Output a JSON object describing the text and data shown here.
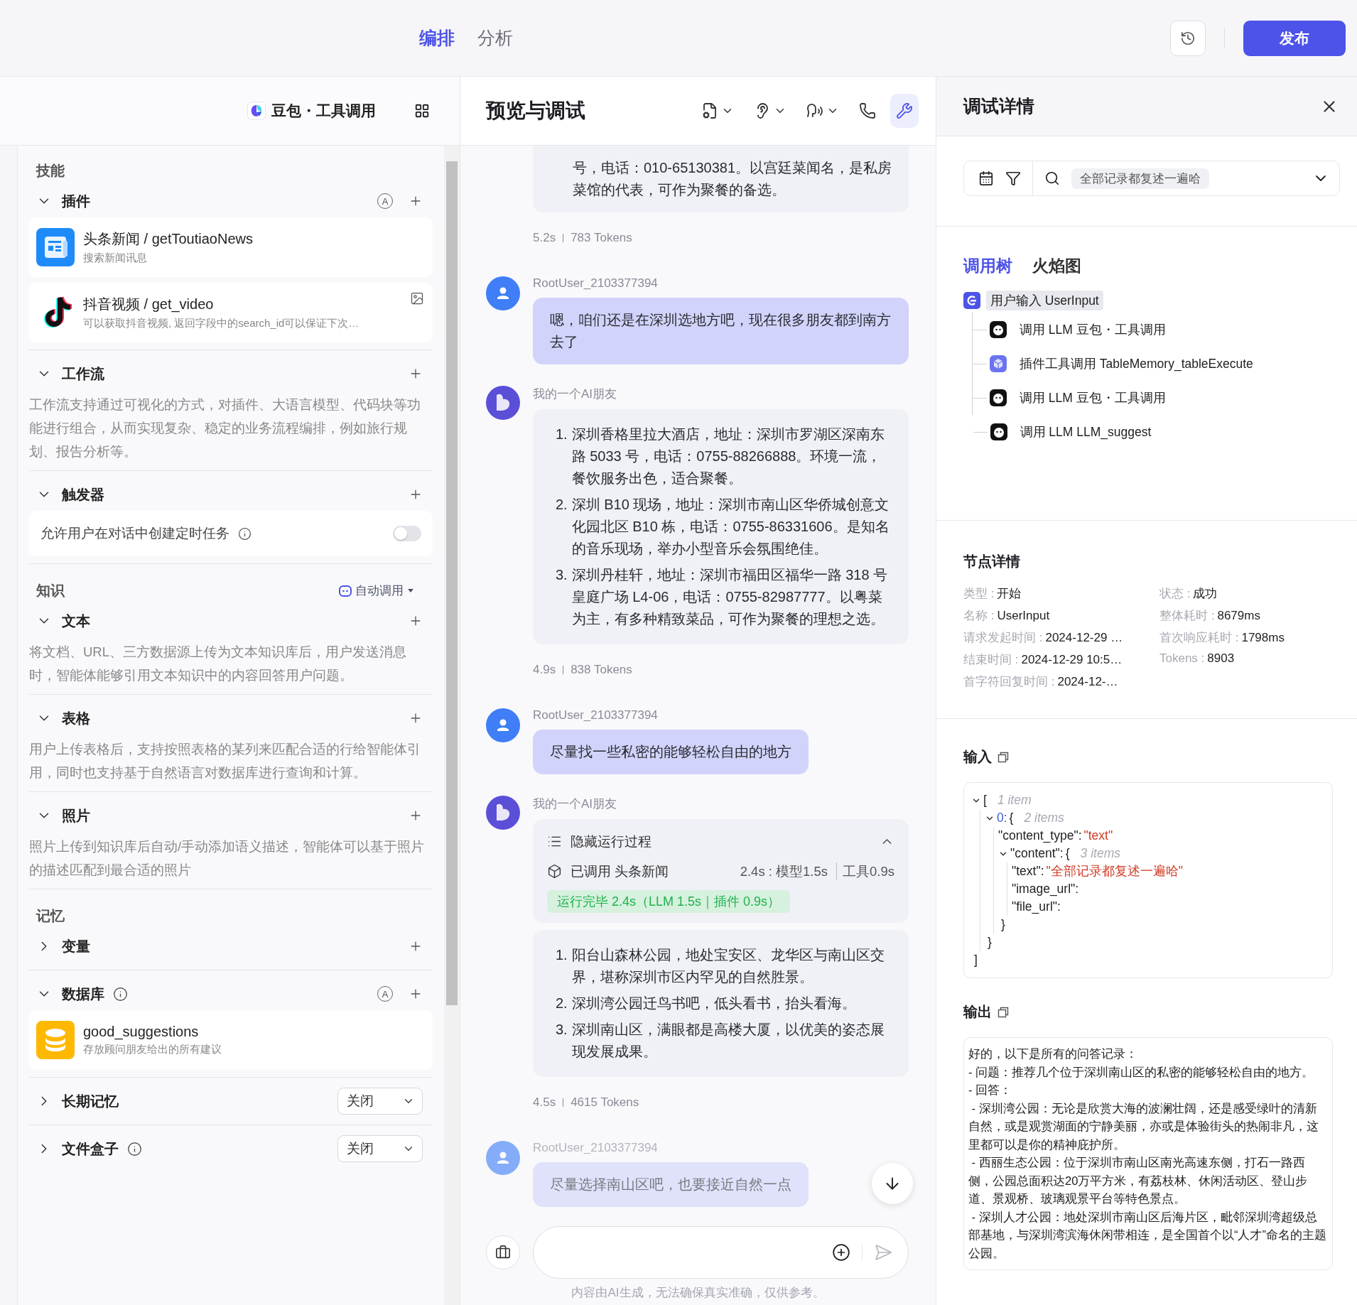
{
  "top_bar": {
    "tabs": [
      {
        "label": "编排",
        "selected": true
      },
      {
        "label": "分析",
        "selected": false
      }
    ],
    "publish": "发布"
  },
  "left_panel": {
    "model": "豆包・工具调用",
    "sections": [
      {
        "title": "技能",
        "groups": [
          {
            "title": "插件",
            "expanded": true,
            "auto_label": "A",
            "add": true,
            "items": [
              {
                "kind": "news",
                "name": "头条新闻 / getToutiaoNews",
                "desc": "搜索新闻讯息"
              },
              {
                "kind": "video",
                "name": "抖音视频 / get_video",
                "desc": "可以获取抖音视频, 返回字段中的search_id可以保证下次…",
                "badge": true
              }
            ]
          },
          {
            "title": "工作流",
            "expanded": true,
            "add": true,
            "description": "工作流支持通过可视化的方式，对插件、大语言模型、代码块等功能进行组合，从而实现复杂、稳定的业务流程编排，例如旅行规划、报告分析等。"
          },
          {
            "title": "触发器",
            "expanded": true,
            "add": true,
            "toggle": {
              "label": "允许用户在对话中创建定时任务",
              "on": false
            }
          }
        ]
      },
      {
        "title": "知识",
        "link": "自动调用",
        "groups": [
          {
            "title": "文本",
            "expanded": true,
            "add": true,
            "description": "将文档、URL、三方数据源上传为文本知识库后，用户发送消息时，智能体能够引用文本知识中的内容回答用户问题。"
          },
          {
            "title": "表格",
            "expanded": true,
            "add": true,
            "description": "用户上传表格后，支持按照表格的某列来匹配合适的行给智能体引用，同时也支持基于自然语言对数据库进行查询和计算。"
          },
          {
            "title": "照片",
            "expanded": true,
            "add": true,
            "description": "照片上传到知识库后自动/手动添加语义描述，智能体可以基于照片的描述匹配到最合适的照片"
          }
        ]
      },
      {
        "title": "记忆",
        "groups": [
          {
            "title": "变量",
            "expanded": false,
            "add": true
          },
          {
            "title": "数据库",
            "expanded": true,
            "auto_label": "A",
            "info": true,
            "add": true,
            "items": [
              {
                "kind": "database",
                "name": "good_suggestions",
                "desc": "存放顾问朋友给出的所有建议"
              }
            ]
          },
          {
            "title": "长期记忆",
            "expanded": false,
            "select": "关闭"
          },
          {
            "title": "文件盒子",
            "expanded": false,
            "info": true,
            "select": "关闭"
          }
        ]
      }
    ]
  },
  "preview": {
    "title": "预览与调试",
    "tools": [
      {
        "kind": "document",
        "dropdown": true,
        "active": false
      },
      {
        "kind": "ear",
        "dropdown": true,
        "active": false
      },
      {
        "kind": "speech",
        "dropdown": true,
        "active": false
      },
      {
        "kind": "phone",
        "dropdown": false,
        "active": false
      },
      {
        "kind": "wrench",
        "dropdown": false,
        "active": true
      }
    ],
    "messages": [
      {
        "kind": "tail",
        "text": "号，电话：010-65130381。以宫廷菜闻名，是私房菜馆的代表，可作为聚餐的备选。"
      },
      {
        "kind": "stats",
        "time": "5.2s",
        "tokens": "783 Tokens"
      },
      {
        "kind": "user",
        "author": "RootUser_2103377394",
        "text": "嗯，咱们还是在深圳选地方吧，现在很多朋友都到南方去了",
        "faded": false
      },
      {
        "kind": "bot",
        "author": "我的一个AI朋友",
        "list": [
          {
            "number": "1.",
            "text": "深圳香格里拉大酒店，地址：深圳市罗湖区深南东路 5033 号，电话：0755-88266888。环境一流，餐饮服务出色，适合聚餐。"
          },
          {
            "number": "2.",
            "text": "深圳 B10 现场，地址：深圳市南山区华侨城创意文化园北区 B10 栋，电话：0755-86331606。是知名的音乐现场，举办小型音乐会氛围绝佳。"
          },
          {
            "number": "3.",
            "text": "深圳丹桂轩，地址：深圳市福田区福华一路 318 号皇庭广场 L4-06，电话：0755-82987777。以粤菜为主，有多种精致菜品，可作为聚餐的理想之选。"
          }
        ]
      },
      {
        "kind": "stats",
        "time": "4.9s",
        "tokens": "838 Tokens"
      },
      {
        "kind": "user",
        "author": "RootUser_2103377394",
        "text": "尽量找一些私密的能够轻松自由的地方",
        "faded": false
      },
      {
        "kind": "bot",
        "author": "我的一个AI朋友",
        "process": {
          "title": "隐藏运行过程",
          "expanded": true,
          "call": "已调用 头条新闻",
          "timing": "2.4s : 模型1.5s",
          "tool_time": "工具0.9s",
          "status": "运行完毕 2.4s（LLM 1.5s｜插件 0.9s）"
        },
        "list": [
          {
            "number": "1.",
            "text": "阳台山森林公园，地处宝安区、龙华区与南山区交界，堪称深圳市区内罕见的自然胜景。"
          },
          {
            "number": "2.",
            "text": "深圳湾公园迁鸟书吧，低头看书，抬头看海。"
          },
          {
            "number": "3.",
            "text": "深圳南山区，满眼都是高楼大厦，以优美的姿态展现发展成果。"
          }
        ]
      },
      {
        "kind": "stats",
        "time": "4.5s",
        "tokens": "4615 Tokens"
      },
      {
        "kind": "user",
        "author": "RootUser_2103377394",
        "text": "尽量选择南山区吧，也要接近自然一点",
        "faded": true
      }
    ],
    "disclaimer": "内容由AI生成，无法确保真实准确，仅供参考。"
  },
  "debug": {
    "title": "调试详情",
    "query": "全部记录都复述一遍哈",
    "tabs": [
      {
        "label": "调用树",
        "selected": true
      },
      {
        "label": "火焰图",
        "selected": false
      }
    ],
    "tree": {
      "kind": "input",
      "label": "用户输入 UserInput",
      "selected": true,
      "children": [
        {
          "kind": "llm",
          "label": "调用 LLM 豆包・工具调用",
          "selected": false
        },
        {
          "kind": "plugin",
          "label": "插件工具调用 TableMemory_tableExecute",
          "selected": false
        },
        {
          "kind": "llm",
          "label": "调用 LLM 豆包・工具调用",
          "selected": false
        },
        {
          "kind": "llm",
          "label": "调用 LLM LLM_suggest",
          "selected": false
        }
      ]
    },
    "details_title": "节点详情",
    "details": [
      {
        "label": "类型 :",
        "value": "开始"
      },
      {
        "label": "状态 :",
        "value": "成功"
      },
      {
        "label": "名称 :",
        "value": "UserInput"
      },
      {
        "label": "整体耗时 :",
        "value": "8679ms"
      },
      {
        "label": "请求发起时间 :",
        "value": "2024-12-29 …"
      },
      {
        "label": "首次响应耗时 :",
        "value": "1798ms"
      },
      {
        "label": "结束时间 :",
        "value": "2024-12-29 10:5…"
      },
      {
        "label": "Tokens :",
        "value": "8903"
      },
      {
        "label": "首字符回复时间 :",
        "value": "2024-12-…"
      }
    ],
    "input_title": "输入",
    "input_json": {
      "open": "[",
      "count": "1 item",
      "close": "]",
      "expanded": true,
      "children": [
        {
          "key": "0:",
          "open": "{",
          "count": "2 items",
          "close": "}",
          "expanded": true,
          "children": [
            {
              "key": "\"content_type\":",
              "value": "\"text\""
            },
            {
              "key": "\"content\":",
              "open": "{",
              "count": "3 items",
              "close": "}",
              "expanded": true,
              "children": [
                {
                  "key": "\"text\":",
                  "value": "\"全部记录都复述一遍哈\""
                },
                {
                  "key": "\"image_url\":"
                },
                {
                  "key": "\"file_url\":"
                }
              ]
            }
          ]
        }
      ]
    },
    "output_title": "输出",
    "output_text": "好的，以下是所有的问答记录：\n- 问题：推荐几个位于深圳南山区的私密的能够轻松自由的地方。\n- 回答：\n - 深圳湾公园：无论是欣赏大海的波澜壮阔，还是感受绿叶的清新自然，或是观赏湖面的宁静美丽，亦或是体验街头的热闹非凡，这里都可以是你的精神庇护所。\n - 西丽生态公园：位于深圳市南山区南光高速东侧，打石一路西侧，公园总面积达20万平方米，有荔枝林、休闲活动区、登山步道、景观桥、玻璃观景平台等特色景点。\n - 深圳人才公园：地处深圳市南山区后海片区，毗邻深圳湾超级总部基地，与深圳湾滨海休闲带相连，是全国首个以“人才”命名的主题公园。"
  }
}
